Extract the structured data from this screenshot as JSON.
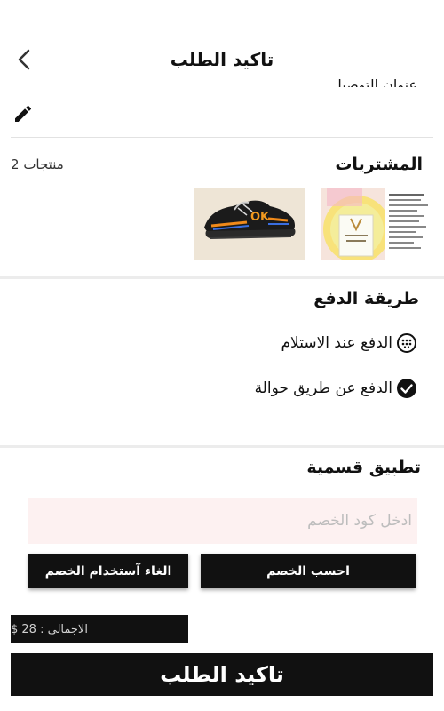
{
  "header": {
    "title": "تاكيد الطلب",
    "back_icon": "chevron-left-icon",
    "peek_text": "عنوان التوصيل"
  },
  "address": {
    "edit_icon": "pencil-icon"
  },
  "products": {
    "title": "المشتريات",
    "count": "2 منتجات",
    "items": [
      {
        "name": "product-cosmetic-box",
        "image": "pink-box-with-card"
      },
      {
        "name": "product-sneaker",
        "image": "black-sneaker-ok"
      }
    ]
  },
  "payment": {
    "title": "طريقة الدفع",
    "options": [
      {
        "label": "الدفع عند الاستلام",
        "icon": "dots-circle-icon",
        "selected": false
      },
      {
        "label": "الدفع عن طريق حوالة",
        "icon": "check-circle-icon",
        "selected": true
      }
    ]
  },
  "discount": {
    "title": "تطبيق قسمية",
    "placeholder": "ادخل كود الخصم",
    "calculate_label": "احسب الخصم",
    "cancel_label": "الغاء آستخدام الخصم"
  },
  "total": {
    "label": "الاجمالي :",
    "value": "28 $"
  },
  "confirm_label": "تاكيد الطلب",
  "colors": {
    "primary": "#111111",
    "input_bg": "#fdf1f1",
    "divider": "#ececec"
  }
}
